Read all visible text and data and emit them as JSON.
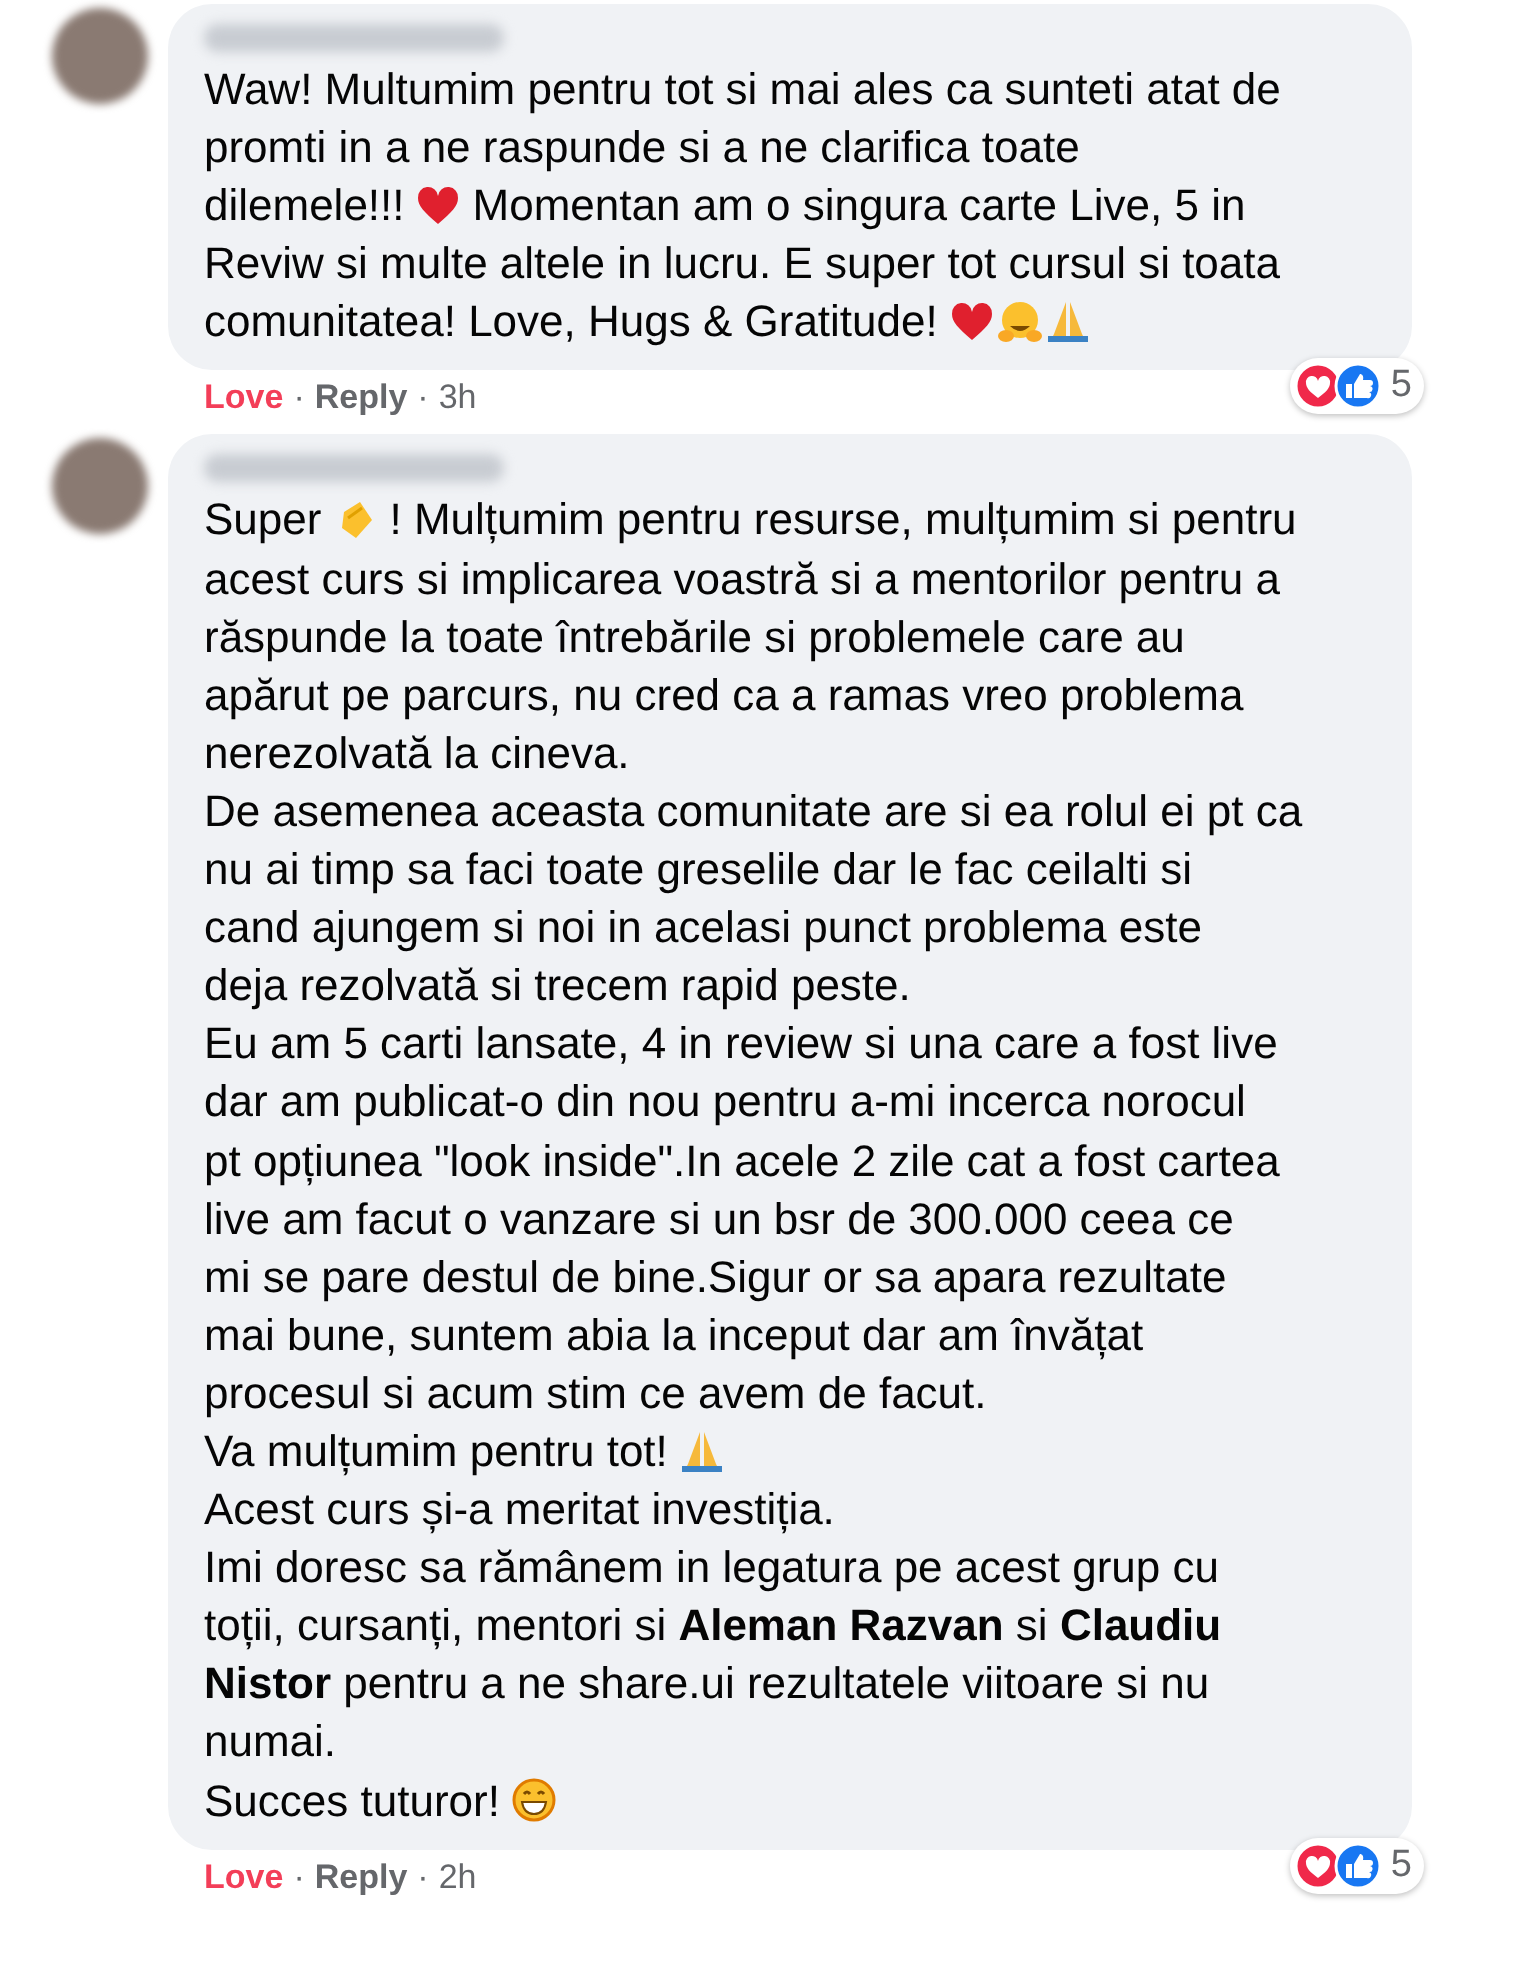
{
  "comments": [
    {
      "lines": [
        [
          {
            "kind": "text",
            "text": "Waw! Multumim pentru tot si mai ales ca sunteti atat de"
          }
        ],
        [
          {
            "kind": "text",
            "text": "promti in a ne raspunde si a ne clarifica toate"
          }
        ],
        [
          {
            "kind": "text",
            "text": "dilemele!!!"
          },
          {
            "kind": "heart"
          },
          {
            "kind": "text",
            "text": "Momentan am o singura carte Live, 5 in"
          }
        ],
        [
          {
            "kind": "text",
            "text": "Reviw si multe altele in lucru. E super tot cursul si toata"
          }
        ],
        [
          {
            "kind": "text",
            "text": "comunitatea! Love, Hugs & Gratitude!"
          },
          {
            "kind": "heart"
          },
          {
            "kind": "hug"
          },
          {
            "kind": "pray"
          }
        ]
      ],
      "reaction_count": "5",
      "reaction_label": "Love",
      "reacted": true,
      "separator": "·",
      "reply": "Reply",
      "time": "3h"
    },
    {
      "lines": [
        [
          {
            "kind": "text",
            "text": "Super"
          },
          {
            "kind": "clap"
          },
          {
            "kind": "text",
            "text": "! Mulțumim pentru resurse, mulțumim si pentru"
          }
        ],
        [
          {
            "kind": "text",
            "text": "acest curs si implicarea voastră si a mentorilor pentru a"
          }
        ],
        [
          {
            "kind": "text",
            "text": "răspunde la toate întrebările si problemele care au"
          }
        ],
        [
          {
            "kind": "text",
            "text": "apărut pe parcurs, nu cred ca a ramas vreo problema"
          }
        ],
        [
          {
            "kind": "text",
            "text": "nerezolvată la cineva."
          }
        ],
        [
          {
            "kind": "text",
            "text": "De asemenea aceasta comunitate are si ea rolul ei pt ca"
          }
        ],
        [
          {
            "kind": "text",
            "text": "nu ai timp sa faci toate greselile dar le fac ceilalti si"
          }
        ],
        [
          {
            "kind": "text",
            "text": "cand ajungem si noi in acelasi punct problema este"
          }
        ],
        [
          {
            "kind": "text",
            "text": "deja rezolvată si trecem rapid peste."
          }
        ],
        [
          {
            "kind": "text",
            "text": "Eu am 5 carti lansate, 4 in review si una care a fost live"
          }
        ],
        [
          {
            "kind": "text",
            "text": "dar am publicat-o din nou pentru a-mi incerca norocul"
          }
        ],
        [
          {
            "kind": "text",
            "text": "pt opțiunea \"look inside\".In acele 2 zile cat a fost cartea"
          }
        ],
        [
          {
            "kind": "text",
            "text": "live am facut o vanzare si un bsr de 300.000 ceea ce"
          }
        ],
        [
          {
            "kind": "text",
            "text": "mi se pare destul de bine.Sigur or sa apara rezultate"
          }
        ],
        [
          {
            "kind": "text",
            "text": "mai bune, suntem abia la inceput dar am învățat"
          }
        ],
        [
          {
            "kind": "text",
            "text": "procesul si acum stim ce avem de facut."
          }
        ],
        [
          {
            "kind": "text",
            "text": "Va mulțumim pentru tot!"
          },
          {
            "kind": "pray"
          }
        ],
        [
          {
            "kind": "text",
            "text": "Acest curs și-a meritat investiția."
          }
        ],
        [
          {
            "kind": "text",
            "text": "Imi doresc sa rămânem in legatura pe acest grup cu"
          }
        ],
        [
          {
            "kind": "text",
            "text": "toții, cursanți, mentori si **Aleman Razvan** si **Claudiu**"
          }
        ],
        [
          {
            "kind": "text",
            "text": "**Nistor** pentru a ne share.ui rezultatele viitoare si nu"
          }
        ],
        [
          {
            "kind": "text",
            "text": "numai."
          }
        ],
        [
          {
            "kind": "text",
            "text": "Succes tuturor!"
          },
          {
            "kind": "grin"
          }
        ]
      ],
      "reaction_count": "5",
      "reaction_label": "Love",
      "reacted": true,
      "separator": "·",
      "reply": "Reply",
      "time": "2h"
    }
  ]
}
